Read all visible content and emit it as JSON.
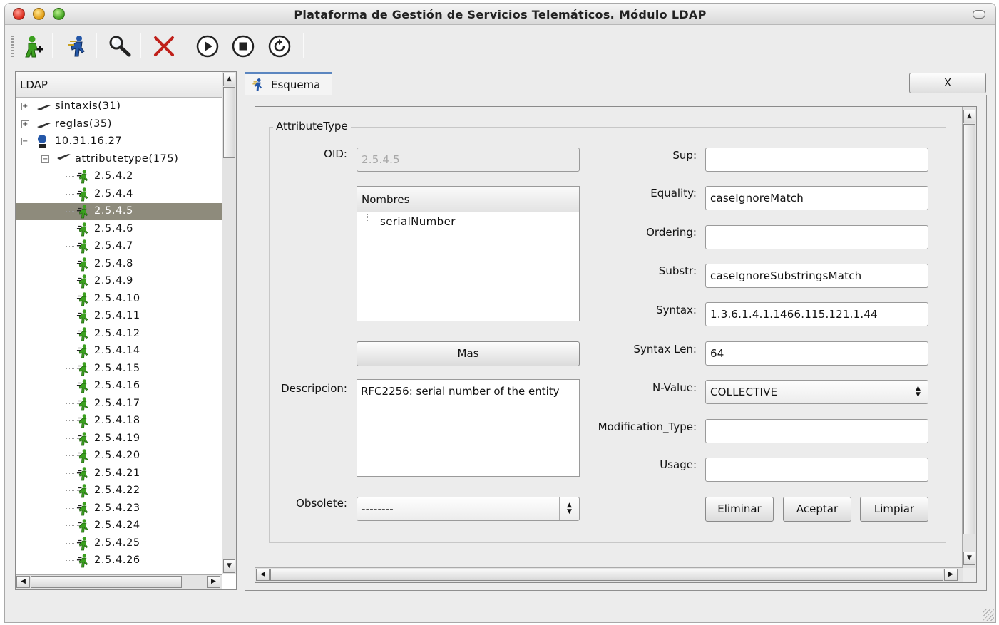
{
  "window": {
    "title": "Plataforma de Gestión de Servicios Telemáticos. Módulo LDAP"
  },
  "toolbar": {
    "buttons": [
      {
        "icon": "add-user-icon"
      },
      {
        "icon": "user-run-icon"
      },
      {
        "icon": "search-icon"
      },
      {
        "icon": "delete-icon"
      },
      {
        "icon": "play-icon"
      },
      {
        "icon": "stop-icon"
      },
      {
        "icon": "refresh-icon"
      }
    ]
  },
  "tree": {
    "header": "LDAP",
    "nodes": [
      {
        "label": "sintaxis(31)"
      },
      {
        "label": "reglas(35)"
      },
      {
        "label": "10.31.16.27"
      },
      {
        "label": "attributetype(175)"
      },
      {
        "label": "2.5.4.2"
      },
      {
        "label": "2.5.4.4"
      },
      {
        "label": "2.5.4.5"
      },
      {
        "label": "2.5.4.6"
      },
      {
        "label": "2.5.4.7"
      },
      {
        "label": "2.5.4.8"
      },
      {
        "label": "2.5.4.9"
      },
      {
        "label": "2.5.4.10"
      },
      {
        "label": "2.5.4.11"
      },
      {
        "label": "2.5.4.12"
      },
      {
        "label": "2.5.4.14"
      },
      {
        "label": "2.5.4.15"
      },
      {
        "label": "2.5.4.16"
      },
      {
        "label": "2.5.4.17"
      },
      {
        "label": "2.5.4.18"
      },
      {
        "label": "2.5.4.19"
      },
      {
        "label": "2.5.4.20"
      },
      {
        "label": "2.5.4.21"
      },
      {
        "label": "2.5.4.22"
      },
      {
        "label": "2.5.4.23"
      },
      {
        "label": "2.5.4.24"
      },
      {
        "label": "2.5.4.25"
      },
      {
        "label": "2.5.4.26"
      }
    ],
    "selected": "2.5.4.5"
  },
  "tabs": {
    "active": "Esquema",
    "close_label": "X"
  },
  "form": {
    "group_title": "AttributeType",
    "oid_label": "OID:",
    "oid_value": "2.5.4.5",
    "nombres_header": "Nombres",
    "nombres": [
      "serialNumber"
    ],
    "mas_label": "Mas",
    "descripcion_label": "Descripcion:",
    "descripcion_value": "RFC2256: serial number of the entity",
    "obsolete_label": "Obsolete:",
    "obsolete_value": "--------",
    "sup_label": "Sup:",
    "sup_value": "",
    "equality_label": "Equality:",
    "equality_value": "caseIgnoreMatch",
    "ordering_label": "Ordering:",
    "ordering_value": "",
    "substr_label": "Substr:",
    "substr_value": "caseIgnoreSubstringsMatch",
    "syntax_label": "Syntax:",
    "syntax_value": "1.3.6.1.4.1.1466.115.121.1.44",
    "syntaxlen_label": "Syntax Len:",
    "syntaxlen_value": "64",
    "nvalue_label": "N-Value:",
    "nvalue_value": "COLLECTIVE",
    "modtype_label": "Modification_Type:",
    "modtype_value": "",
    "usage_label": "Usage:",
    "usage_value": "",
    "eliminar_label": "Eliminar",
    "aceptar_label": "Aceptar",
    "limpiar_label": "Limpiar"
  },
  "colors": {
    "selection": "#8e8b7c",
    "tab_accent": "#5b86c0",
    "icon_green": "#3ca020",
    "icon_blue": "#2457a8",
    "delete_red": "#c0201a"
  }
}
